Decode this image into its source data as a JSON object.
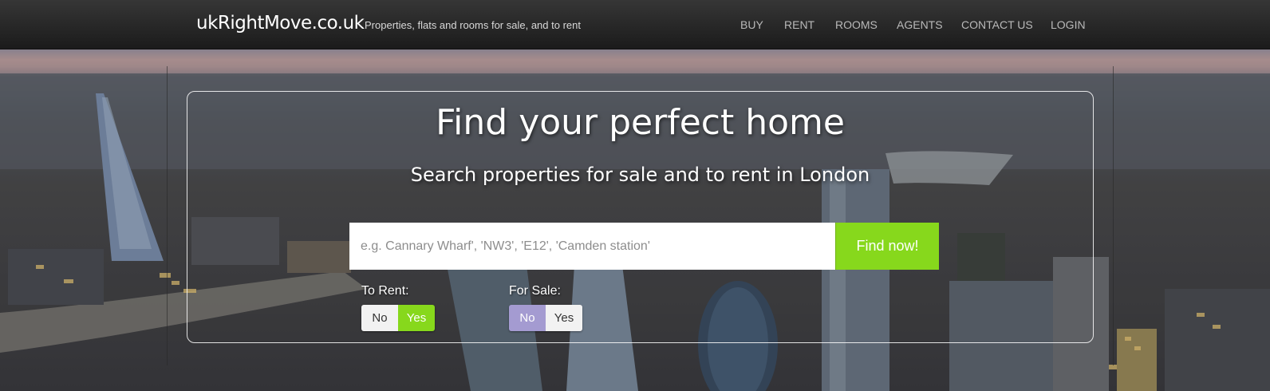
{
  "header": {
    "brand": "ukRightMove.co.uk",
    "tagline": "Properties, flats and rooms for sale, and to rent",
    "nav": [
      "BUY",
      "RENT",
      "ROOMS",
      "AGENTS",
      "CONTACT US",
      "LOGIN"
    ]
  },
  "hero": {
    "headline": "Find your perfect home",
    "subline": "Search properties for sale and to rent in London"
  },
  "search": {
    "placeholder": "e.g. Cannary Wharf', 'NW3', 'E12', 'Camden station'",
    "button_label": "Find now!"
  },
  "filters": {
    "rent": {
      "label": "To Rent:",
      "no": "No",
      "yes": "Yes",
      "selected": "Yes"
    },
    "sale": {
      "label": "For Sale:",
      "no": "No",
      "yes": "Yes",
      "selected": "No"
    }
  },
  "colors": {
    "accent_green": "#87d81c",
    "accent_purple": "#a49bd1",
    "header_bg": "#2a2a2a"
  }
}
